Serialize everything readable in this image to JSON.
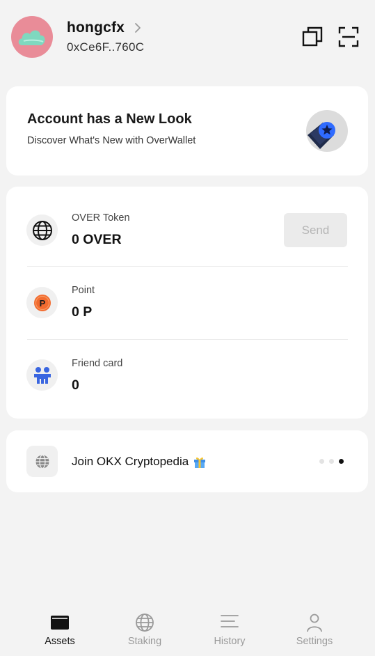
{
  "header": {
    "username": "hongcfx",
    "address": "0xCe6F..760C"
  },
  "promo": {
    "title": "Account has a New Look",
    "subtitle": "Discover What's New with OverWallet"
  },
  "assets": [
    {
      "label": "OVER Token",
      "value": "0 OVER",
      "icon": "globe-icon"
    },
    {
      "label": "Point",
      "value": "0 P",
      "icon": "point-coin-icon"
    },
    {
      "label": "Friend card",
      "value": "0",
      "icon": "friends-icon"
    }
  ],
  "send_label": "Send",
  "cryptopedia": {
    "text": "Join OKX Cryptopedia",
    "dots_total": 3,
    "active_dot": 3
  },
  "nav": [
    {
      "label": "Assets",
      "icon": "wallet-icon",
      "active": true
    },
    {
      "label": "Staking",
      "icon": "globe-icon",
      "active": false
    },
    {
      "label": "History",
      "icon": "list-icon",
      "active": false
    },
    {
      "label": "Settings",
      "icon": "person-icon",
      "active": false
    }
  ],
  "colors": {
    "background": "#f3f3f3",
    "avatar": "#e98c98",
    "point_coin": "#f26b2f",
    "friends_blue": "#3a66e0",
    "badge_blue": "#2f6bff"
  }
}
